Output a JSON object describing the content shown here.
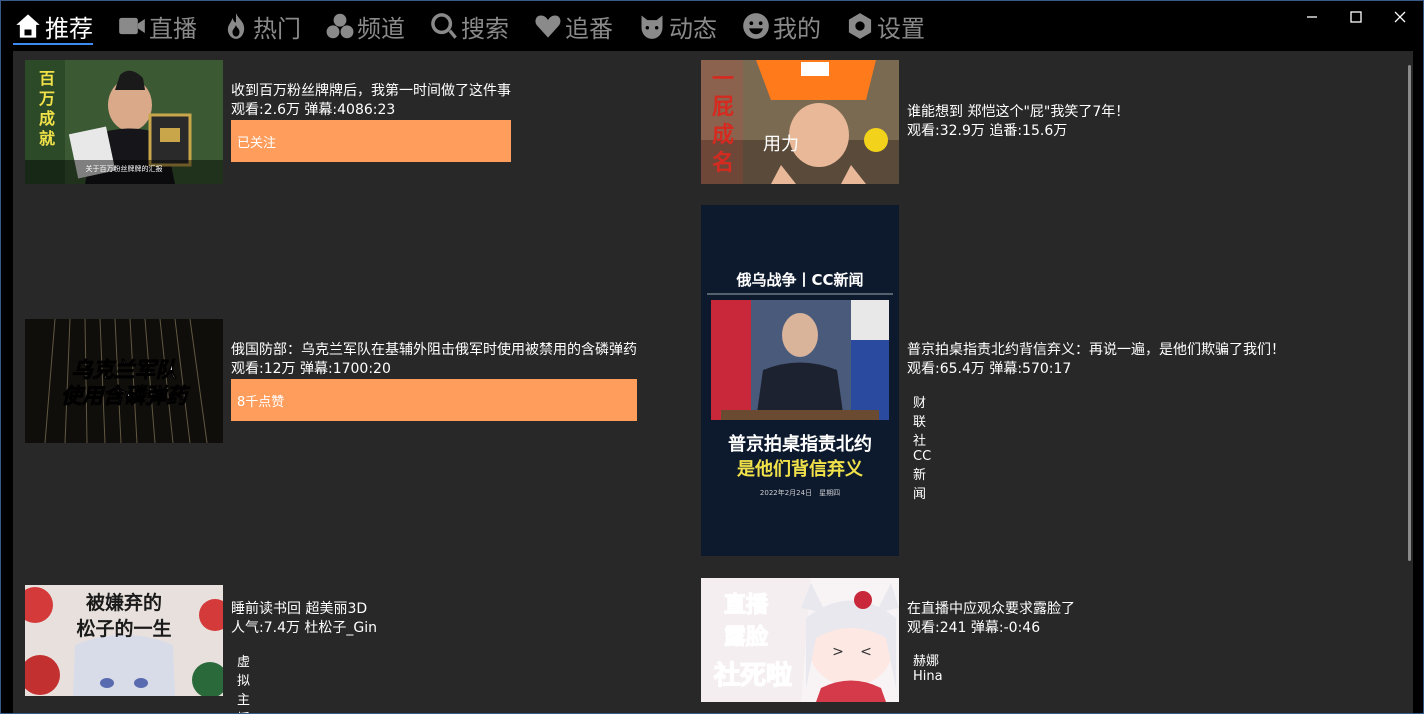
{
  "tabs": [
    {
      "label": "推荐",
      "icon": "home-icon",
      "active": true
    },
    {
      "label": "直播",
      "icon": "video-camera-icon",
      "active": false
    },
    {
      "label": "热门",
      "icon": "fire-icon",
      "active": false
    },
    {
      "label": "频道",
      "icon": "channels-icon",
      "active": false
    },
    {
      "label": "搜索",
      "icon": "search-icon",
      "active": false
    },
    {
      "label": "追番",
      "icon": "heart-icon",
      "active": false
    },
    {
      "label": "动态",
      "icon": "dynamic-icon",
      "active": false
    },
    {
      "label": "我的",
      "icon": "smiley-icon",
      "active": false
    },
    {
      "label": "设置",
      "icon": "gear-icon",
      "active": false
    }
  ],
  "window_controls": [
    "minimize-icon",
    "maximize-icon",
    "close-icon"
  ],
  "colors": {
    "accent": "#3d8bf0",
    "button": "#ff9d5c",
    "panel": "#282828"
  },
  "cards": [
    {
      "title": "收到百万粉丝牌牌后，我第一时间做了这件事",
      "stats": "观看:2.6万 弹幕:4086:23",
      "action": "已关注",
      "thumb_text": [
        "百",
        "万",
        "成",
        "就"
      ],
      "thumb_caption": "关于百万粉丝牌牌的汇报"
    },
    {
      "title": "谁能想到 郑恺这个\"屁\"我笑了7年！",
      "stats": "观看:32.9万 追番:15.6万",
      "thumb_text": [
        "一",
        "屁",
        "成",
        "名"
      ],
      "thumb_caption": "用力"
    },
    {
      "title": "俄国防部：乌克兰军队在基辅外阻击俄军时使用被禁用的含磷弹药",
      "stats": "观看:12万 弹幕:1700:20",
      "action": "8千点赞",
      "thumb_text": [
        "乌克兰军队",
        "使用含磷弹药"
      ]
    },
    {
      "title": "普京拍桌指责北约背信弃义：再说一遍，是他们欺骗了我们！",
      "stats": "观看:65.4万 弹幕:570:17",
      "owner": "财联社CC新闻",
      "thumb_header": "俄乌战争丨CC新闻",
      "thumb_lines": [
        "普京拍桌指责北约",
        "是他们背信弃义"
      ],
      "thumb_date": "2022年2月24日　星期四"
    },
    {
      "title": "睡前读书回 超美丽3D",
      "stats": "人气:7.4万 杜松子_Gin",
      "owner": "虚拟主播",
      "thumb_text": [
        "被嫌弃的",
        "松子的一生"
      ]
    },
    {
      "title": "在直播中应观众要求露脸了",
      "stats": "观看:241 弹幕:-0:46",
      "owner": "赫娜Hina",
      "thumb_text": [
        "直播",
        "露脸",
        "社死啦"
      ]
    }
  ]
}
